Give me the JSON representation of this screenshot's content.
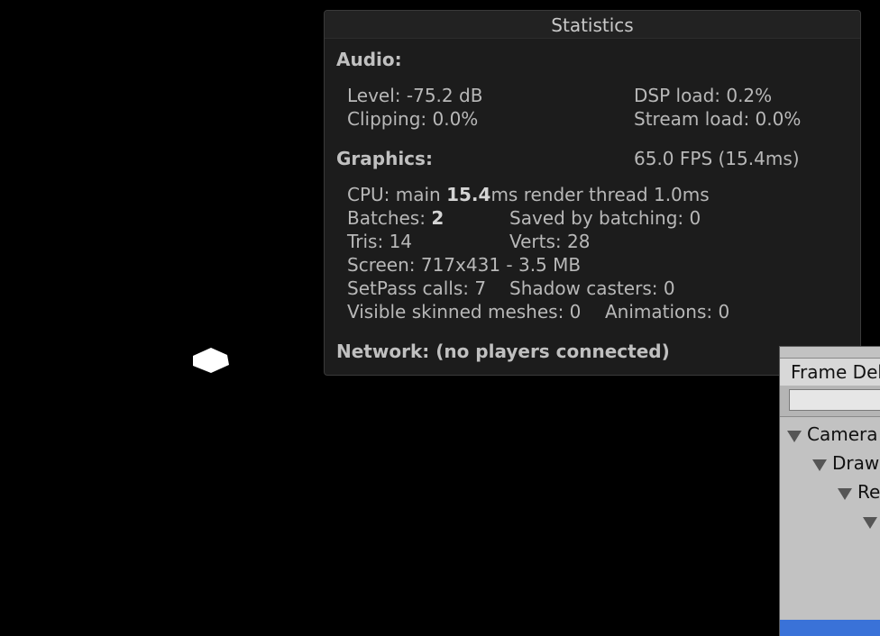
{
  "statistics": {
    "title": "Statistics",
    "audio": {
      "heading": "Audio:",
      "level": "Level: -75.2 dB",
      "clipping": "Clipping: 0.0%",
      "dsp_load": "DSP load: 0.2%",
      "stream_load": "Stream load: 0.0%"
    },
    "graphics": {
      "heading": "Graphics:",
      "fps": "65.0 FPS (15.4ms)",
      "cpu_prefix": "CPU: main ",
      "cpu_main": "15.4",
      "cpu_suffix": "ms  render thread 1.0ms",
      "batches_prefix": "Batches: ",
      "batches_value": "2",
      "saved_by_batching": "Saved by batching: 0",
      "tris": "Tris: 14",
      "verts": "Verts: 28",
      "screen": "Screen: 717x431 - 3.5 MB",
      "setpass": "SetPass calls: 7",
      "shadow_casters": "Shadow casters: 0",
      "skinned_meshes": "Visible skinned meshes: 0",
      "animations": "Animations: 0"
    },
    "network": "Network: (no players connected)"
  },
  "frame_debugger": {
    "tab_label": "Frame Debug",
    "tree": [
      {
        "label": "Camera"
      },
      {
        "label": "Draw"
      },
      {
        "label": "Re"
      },
      {
        "label": ""
      }
    ]
  },
  "colors": {
    "panel_bg": "#1c1c1c",
    "selection": "#3a72d8"
  }
}
